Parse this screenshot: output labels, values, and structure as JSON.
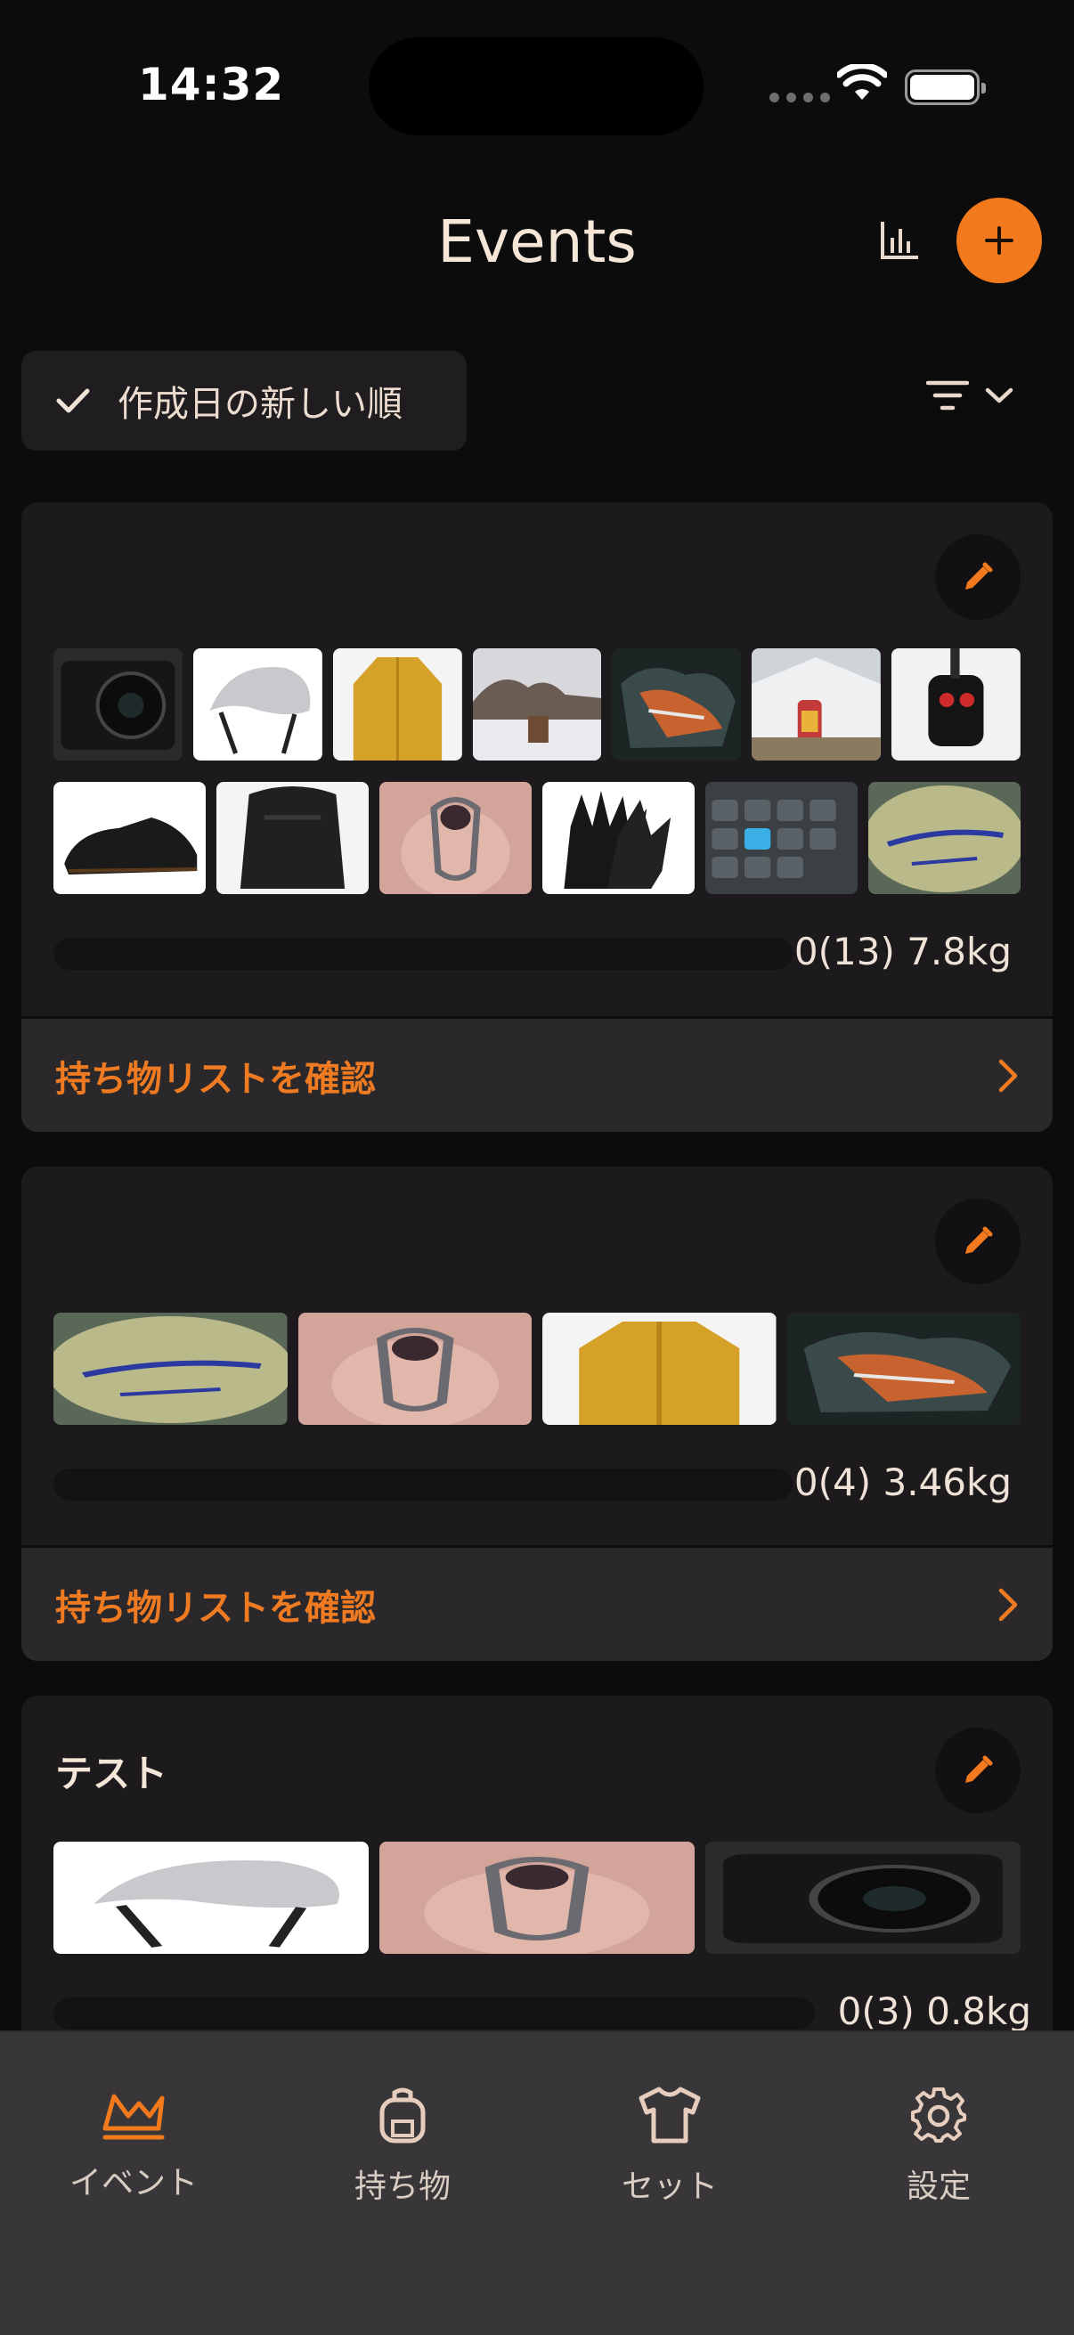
{
  "status": {
    "time": "14:32"
  },
  "header": {
    "title": "Events"
  },
  "sort": {
    "label": "作成日の新しい順"
  },
  "colors": {
    "accent": "#f27a1c",
    "background": "#0c0c0c",
    "card": "#1c1a1c"
  },
  "events": [
    {
      "title": "",
      "weight_text": "0(13) 7.8kg",
      "cta": "持ち物リストを確認",
      "row1": [
        "camera",
        "helmet",
        "yellow-jacket",
        "stove-outdoor",
        "sleeping-bag",
        "tent-bottle",
        "bike-light"
      ],
      "row2": [
        "shoe",
        "backpack",
        "carabiner",
        "gloves",
        "keyboard",
        "mattress"
      ]
    },
    {
      "title": "",
      "weight_text": "0(4) 3.46kg",
      "cta": "持ち物リストを確認",
      "row1": [
        "mattress",
        "carabiner",
        "yellow-jacket",
        "sleeping-bag"
      ]
    },
    {
      "title": "テスト",
      "weight_text": "0(3) 0.8kg",
      "row1": [
        "helmet",
        "carabiner",
        "camera"
      ]
    }
  ],
  "tabs": [
    {
      "label": "イベント",
      "icon": "mountain-icon",
      "active": true
    },
    {
      "label": "持ち物",
      "icon": "backpack-icon"
    },
    {
      "label": "セット",
      "icon": "shirt-icon"
    },
    {
      "label": "設定",
      "icon": "gear-icon"
    }
  ]
}
